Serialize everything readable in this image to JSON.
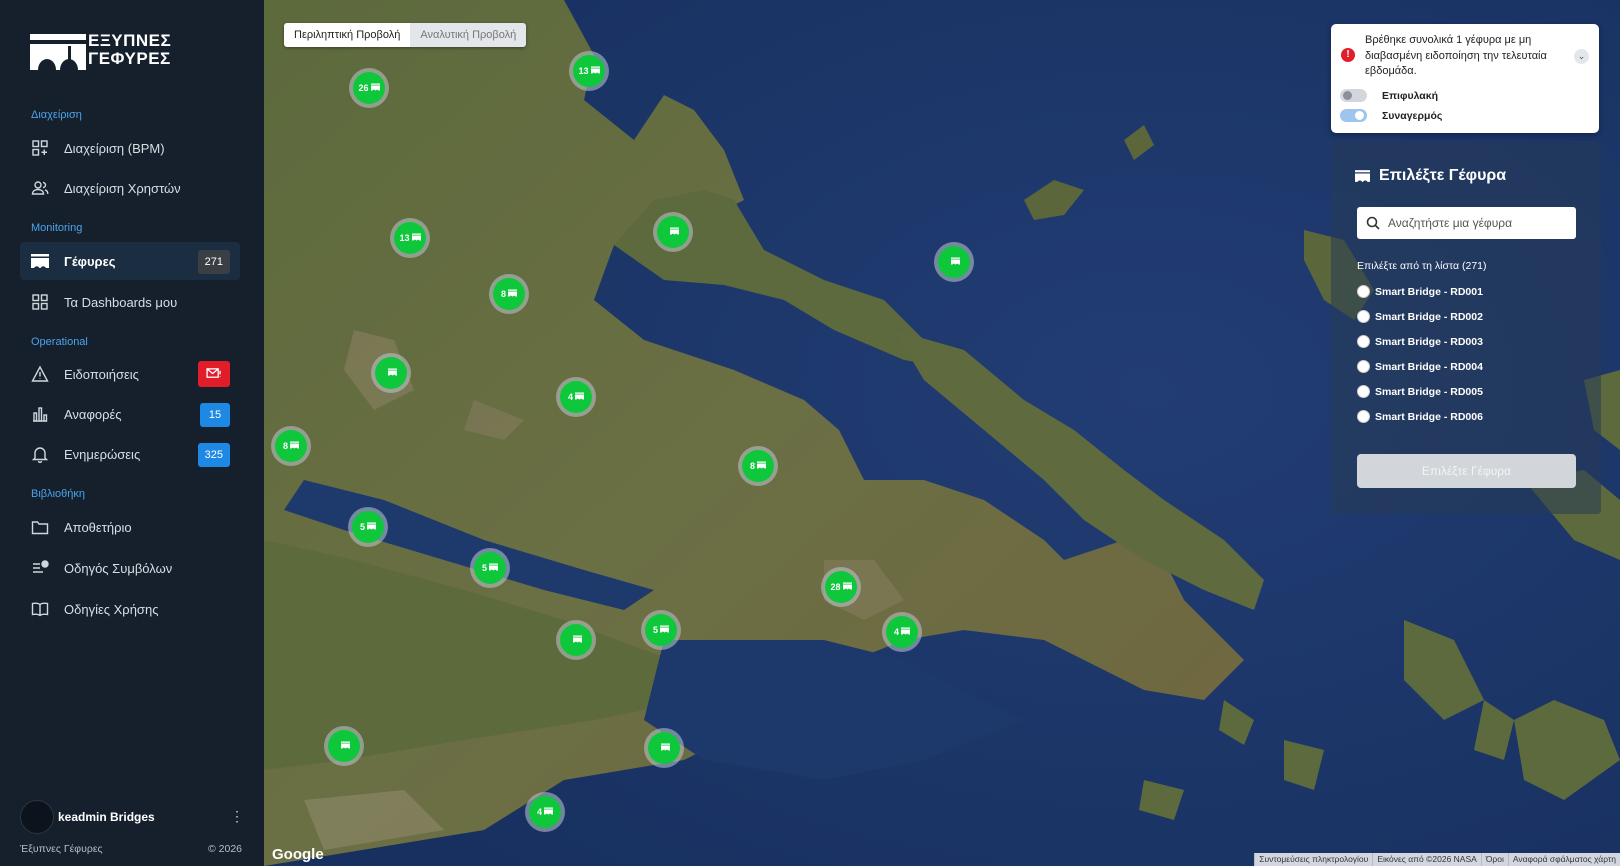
{
  "sidebar": {
    "logo": {
      "line1": "ΕΞΥΠΝΕΣ",
      "line2": "ΓΕΦΥΡΕΣ"
    },
    "sections": [
      {
        "title": "Διαχείριση"
      },
      {
        "title": "Monitoring"
      },
      {
        "title": "Operational"
      },
      {
        "title": "Βιβλιοθήκη"
      }
    ],
    "items": [
      {
        "label": "Διαχείριση (BPM)",
        "icon": "grid-plus-icon"
      },
      {
        "label": "Διαχείριση Χρηστών",
        "icon": "users-icon"
      },
      {
        "label": "Γέφυρες",
        "icon": "bridge-icon",
        "badge": "271",
        "badge_color": "#3a3f45",
        "active": true
      },
      {
        "label": "Τα Dashboards μου",
        "icon": "dashboard-icon"
      },
      {
        "label": "Ειδοποιήσεις",
        "icon": "warning-icon",
        "badge_icon": "mail-alert-icon",
        "badge_color": "#e11d2a"
      },
      {
        "label": "Αναφορές",
        "icon": "bar-chart-icon",
        "badge": "15",
        "badge_color": "#1e88e5"
      },
      {
        "label": "Ενημερώσεις",
        "icon": "bell-icon",
        "badge": "325",
        "badge_color": "#1e88e5"
      },
      {
        "label": "Αποθετήριο",
        "icon": "folder-icon"
      },
      {
        "label": "Οδηγός Συμβόλων",
        "icon": "symbols-guide-icon"
      },
      {
        "label": "Οδηγίες Χρήσης",
        "icon": "book-icon"
      }
    ],
    "user": {
      "name": "keadmin Bridges"
    },
    "footer": {
      "brand": "Έξυπνες Γέφυρες",
      "copyright": "© 2026"
    }
  },
  "map": {
    "view_toggle": {
      "summary": "Περιληπτική Προβολή",
      "detail": "Αναλυτική Προβολή",
      "selected": "summary"
    },
    "clusters": [
      "26",
      "13",
      "",
      "13",
      "8",
      "",
      "4",
      "",
      "8",
      "8",
      "5",
      "5",
      "",
      "5",
      "28",
      "4",
      "",
      "",
      "4"
    ],
    "google_label": "Google",
    "attribution": [
      "Συντομεύσεις πληκτρολογίου",
      "Εικόνες από ©2026 NASA",
      "Όροι",
      "Αναφορά σφάλματος χάρτη"
    ]
  },
  "alert": {
    "message": "Βρέθηκε συνολικά 1 γέφυρα με μη διαβασμένη ειδοποίηση την τελευταία εβδομάδα.",
    "toggles": [
      {
        "label": "Επιφυλακή",
        "on": false
      },
      {
        "label": "Συναγερμός",
        "on": true
      }
    ]
  },
  "bridge_panel": {
    "title": "Επιλέξτε Γέφυρα",
    "search_placeholder": "Αναζητήστε μια γέφυρα",
    "list_header": "Επιλέξτε από τη λίστα (271)",
    "bridges": [
      "Smart Bridge - RD001",
      "Smart Bridge - RD002",
      "Smart Bridge - RD003",
      "Smart Bridge - RD004",
      "Smart Bridge - RD005",
      "Smart Bridge - RD006"
    ],
    "button_label": "Επιλέξτε Γέφυρα"
  },
  "colors": {
    "sidebar_bg": "#16202c",
    "accent_blue": "#4aa3ea",
    "marker_green": "#0fc73b",
    "alert_red": "#e11d2a"
  }
}
